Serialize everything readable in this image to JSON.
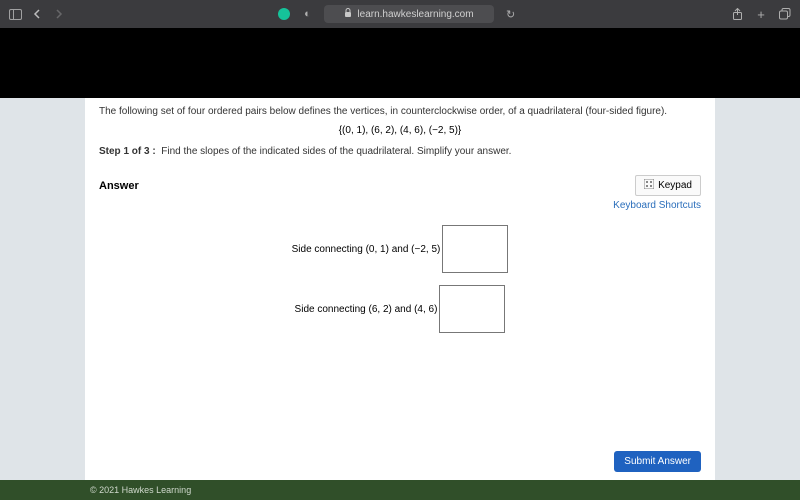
{
  "browser": {
    "url": "learn.hawkeslearning.com"
  },
  "question": {
    "intro": "The following set of four ordered pairs below defines the vertices, in counterclockwise order, of a quadrilateral (four-sided figure).",
    "set": "{(0, 1), (6, 2), (4, 6), (−2, 5)}",
    "step_label": "Step 1 of 3 :",
    "step_text": "Find the slopes of the indicated sides of the quadrilateral. Simplify your answer."
  },
  "answer": {
    "title": "Answer",
    "keypad_label": "Keypad",
    "shortcuts_label": "Keyboard Shortcuts",
    "rows": [
      {
        "prefix": "Side connecting ",
        "p1": "(0, 1)",
        "mid": " and ",
        "p2": "(−2, 5)"
      },
      {
        "prefix": "Side connecting ",
        "p1": "(6, 2)",
        "mid": " and ",
        "p2": "(4, 6)"
      }
    ],
    "submit_label": "Submit Answer"
  },
  "footer": {
    "copyright": "© 2021 Hawkes Learning"
  }
}
